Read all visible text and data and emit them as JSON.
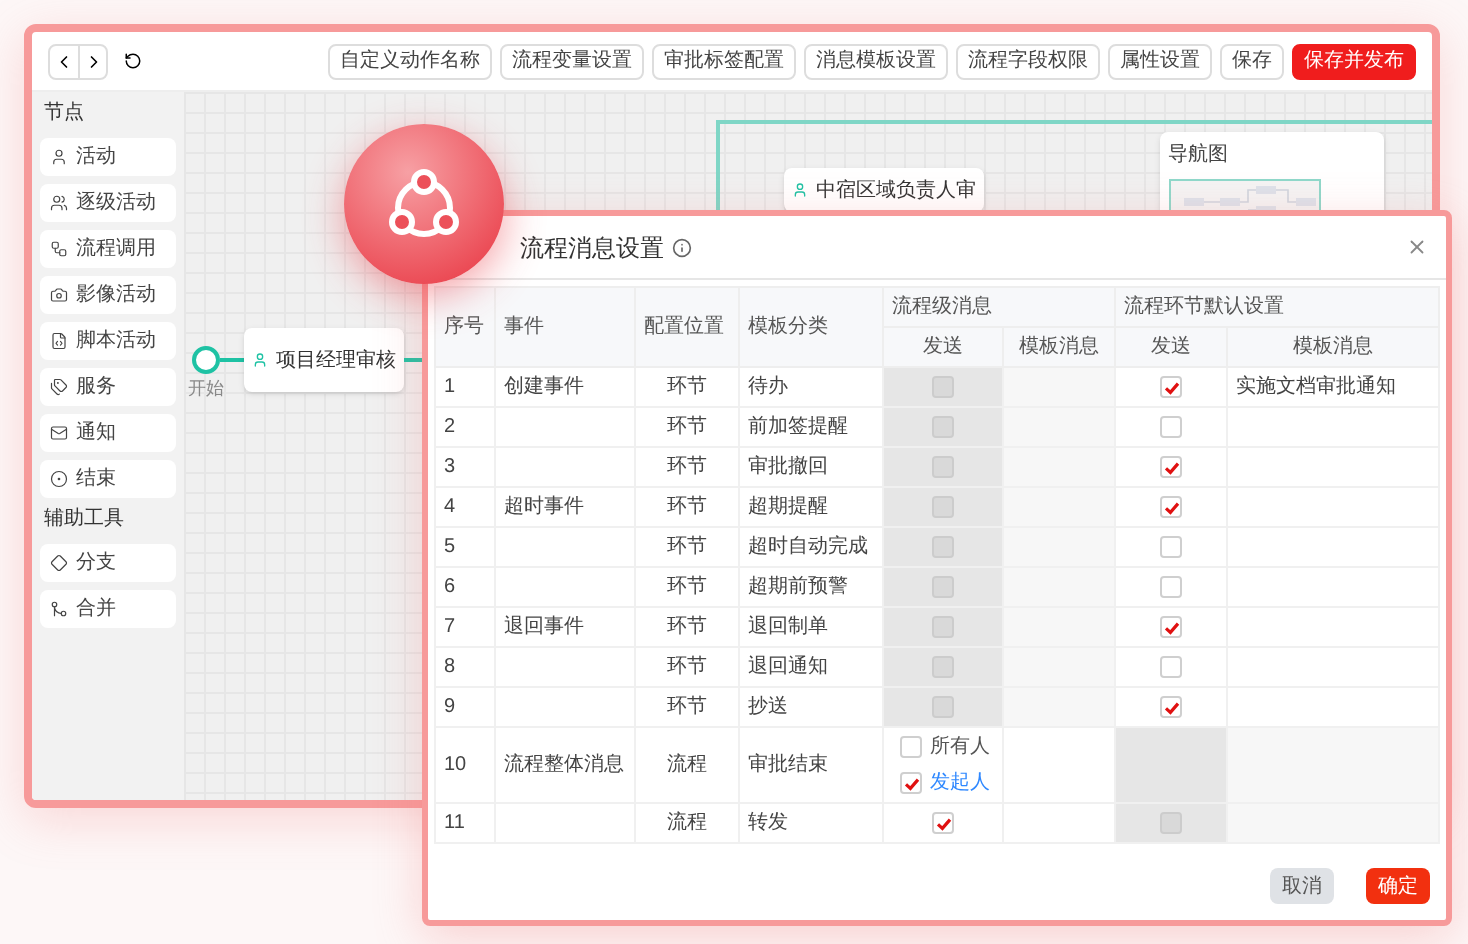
{
  "toolbar": {
    "buttons": [
      {
        "label": "自定义动作名称",
        "kind": "default"
      },
      {
        "label": "流程变量设置",
        "kind": "default"
      },
      {
        "label": "审批标签配置",
        "kind": "default"
      },
      {
        "label": "消息模板设置",
        "kind": "default"
      },
      {
        "label": "流程字段权限",
        "kind": "default"
      },
      {
        "label": "属性设置",
        "kind": "default"
      },
      {
        "label": "保存",
        "kind": "default"
      },
      {
        "label": "保存并发布",
        "kind": "primary"
      }
    ]
  },
  "sidebar": {
    "sections": [
      {
        "title": "节点",
        "items": [
          {
            "label": "活动",
            "kind": "user"
          },
          {
            "label": "逐级活动",
            "kind": "users"
          },
          {
            "label": "流程调用",
            "kind": "call"
          },
          {
            "label": "影像活动",
            "kind": "camera"
          },
          {
            "label": "脚本活动",
            "kind": "script"
          },
          {
            "label": "服务",
            "kind": "service"
          },
          {
            "label": "通知",
            "kind": "mail"
          },
          {
            "label": "结束",
            "kind": "end"
          }
        ]
      },
      {
        "title": "辅助工具",
        "items": [
          {
            "label": "分支",
            "kind": "branch"
          },
          {
            "label": "合并",
            "kind": "merge"
          }
        ]
      }
    ]
  },
  "canvas": {
    "start_label": "开始",
    "nodes": [
      {
        "label": "项目经理审核"
      },
      {
        "label": "中宿区域负责人审"
      }
    ],
    "navigator": {
      "title": "导航图"
    }
  },
  "dialog": {
    "title": "流程消息设置",
    "columns": {
      "no": "序号",
      "event": "事件",
      "position": "配置位置",
      "category": "模板分类",
      "process_group": "流程级消息",
      "node_group": "流程环节默认设置",
      "send": "发送",
      "template": "模板消息",
      "node_send": "发送",
      "node_template": "模板消息"
    },
    "rows": [
      {
        "no": "1",
        "event": "创建事件",
        "position": "环节",
        "category": "待办",
        "process_disabled": true,
        "process_send": {
          "kind": "checkbox",
          "checked": false
        },
        "node_disabled": false,
        "node_send": {
          "kind": "checkbox",
          "checked": true
        },
        "node_template": "实施文档审批通知"
      },
      {
        "no": "2",
        "position": "环节",
        "category": "前加签提醒",
        "process_disabled": true,
        "process_send": {
          "kind": "checkbox",
          "checked": false
        },
        "node_disabled": false,
        "node_send": {
          "kind": "checkbox",
          "checked": false
        }
      },
      {
        "no": "3",
        "position": "环节",
        "category": "审批撤回",
        "process_disabled": true,
        "process_send": {
          "kind": "checkbox",
          "checked": false
        },
        "node_disabled": false,
        "node_send": {
          "kind": "checkbox",
          "checked": true
        }
      },
      {
        "no": "4",
        "event": "超时事件",
        "position": "环节",
        "category": "超期提醒",
        "process_disabled": true,
        "process_send": {
          "kind": "checkbox",
          "checked": false
        },
        "node_disabled": false,
        "node_send": {
          "kind": "checkbox",
          "checked": true
        }
      },
      {
        "no": "5",
        "position": "环节",
        "category": "超时自动完成",
        "process_disabled": true,
        "process_send": {
          "kind": "checkbox",
          "checked": false
        },
        "node_disabled": false,
        "node_send": {
          "kind": "checkbox",
          "checked": false
        }
      },
      {
        "no": "6",
        "position": "环节",
        "category": "超期前预警",
        "process_disabled": true,
        "process_send": {
          "kind": "checkbox",
          "checked": false
        },
        "node_disabled": false,
        "node_send": {
          "kind": "checkbox",
          "checked": false
        }
      },
      {
        "no": "7",
        "event": "退回事件",
        "position": "环节",
        "category": "退回制单",
        "process_disabled": true,
        "process_send": {
          "kind": "checkbox",
          "checked": false
        },
        "node_disabled": false,
        "node_send": {
          "kind": "checkbox",
          "checked": true
        }
      },
      {
        "no": "8",
        "position": "环节",
        "category": "退回通知",
        "process_disabled": true,
        "process_send": {
          "kind": "checkbox",
          "checked": false
        },
        "node_disabled": false,
        "node_send": {
          "kind": "checkbox",
          "checked": false
        }
      },
      {
        "no": "9",
        "position": "环节",
        "category": "抄送",
        "process_disabled": true,
        "process_send": {
          "kind": "checkbox",
          "checked": false
        },
        "node_disabled": false,
        "node_send": {
          "kind": "checkbox",
          "checked": true
        }
      },
      {
        "no": "10",
        "event": "流程整体消息",
        "position": "流程",
        "category": "审批结束",
        "process_disabled": false,
        "process_send": {
          "kind": "options",
          "options": [
            {
              "label": "所有人",
              "checked": false
            },
            {
              "label": "发起人",
              "checked": true
            }
          ]
        },
        "node_disabled": true,
        "node_send": {
          "kind": "none"
        }
      },
      {
        "no": "11",
        "position": "流程",
        "category": "转发",
        "process_disabled": false,
        "process_send": {
          "kind": "checkbox",
          "checked": true
        },
        "node_disabled": true,
        "node_send": {
          "kind": "checkbox",
          "checked": false
        }
      }
    ],
    "buttons": [
      {
        "label": "取消",
        "kind": "default"
      },
      {
        "label": "确定",
        "kind": "primary"
      }
    ]
  }
}
